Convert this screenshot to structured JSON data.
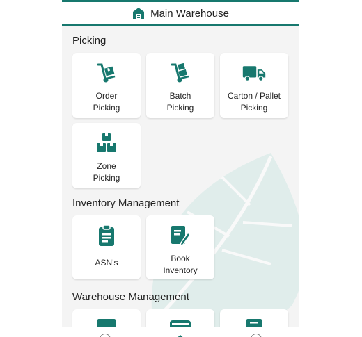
{
  "header": {
    "title": "Main Warehouse",
    "icon": "warehouse-icon"
  },
  "sections": {
    "picking": {
      "title": "Picking",
      "items": [
        {
          "label": "Order\nPicking",
          "icon": "hand-truck-box-icon"
        },
        {
          "label": "Batch\nPicking",
          "icon": "hand-truck-boxes-icon"
        },
        {
          "label": "Carton / Pallet\nPicking",
          "icon": "truck-icon"
        },
        {
          "label": "Zone\nPicking",
          "icon": "boxes-stack-icon"
        }
      ]
    },
    "inventory": {
      "title": "Inventory Management",
      "items": [
        {
          "label": "ASN's",
          "icon": "clipboard-icon"
        },
        {
          "label": "Book\nInventory",
          "icon": "edit-document-icon"
        }
      ]
    },
    "warehouse": {
      "title": "Warehouse Management",
      "items": [
        {
          "label": "",
          "icon": "box-icon"
        },
        {
          "label": "",
          "icon": "archive-icon"
        },
        {
          "label": "",
          "icon": "document-icon"
        }
      ]
    }
  },
  "colors": {
    "accent": "#17786e",
    "background": "#f4f4f4",
    "leaf": "#cde7e3"
  }
}
